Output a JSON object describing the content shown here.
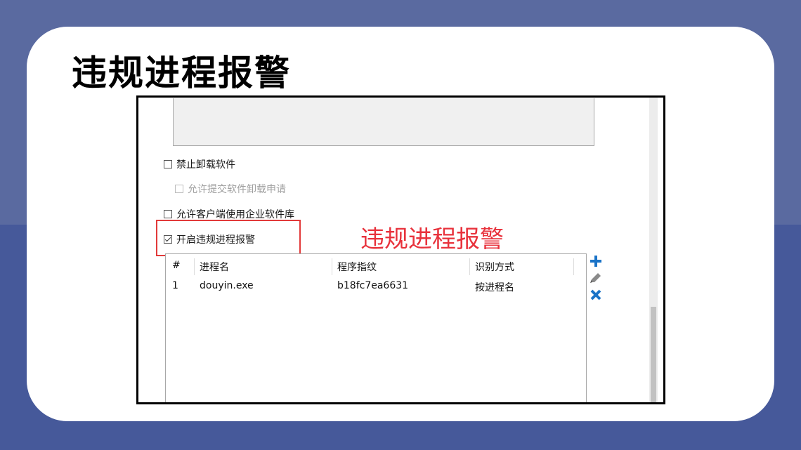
{
  "slide": {
    "title": "违规进程报警"
  },
  "settings": {
    "options": [
      {
        "label": "禁止卸载软件",
        "checked": false,
        "disabled": false
      },
      {
        "label": "允许提交软件卸载申请",
        "checked": false,
        "disabled": true
      },
      {
        "label": "允许客户端使用企业软件库",
        "checked": false,
        "disabled": false
      },
      {
        "label": "开启违规进程报警",
        "checked": true,
        "disabled": false
      }
    ]
  },
  "annotation": {
    "label": "违规进程报警",
    "color": "#e8323c"
  },
  "process_table": {
    "columns": [
      "#",
      "进程名",
      "程序指纹",
      "识别方式"
    ],
    "rows": [
      [
        "1",
        "douyin.exe",
        "b18fc7ea6631",
        "按进程名"
      ]
    ]
  },
  "toolbar": {
    "icons": [
      "plus-icon",
      "pencil-icon",
      "close-icon"
    ],
    "accent": "#1a73c7"
  }
}
